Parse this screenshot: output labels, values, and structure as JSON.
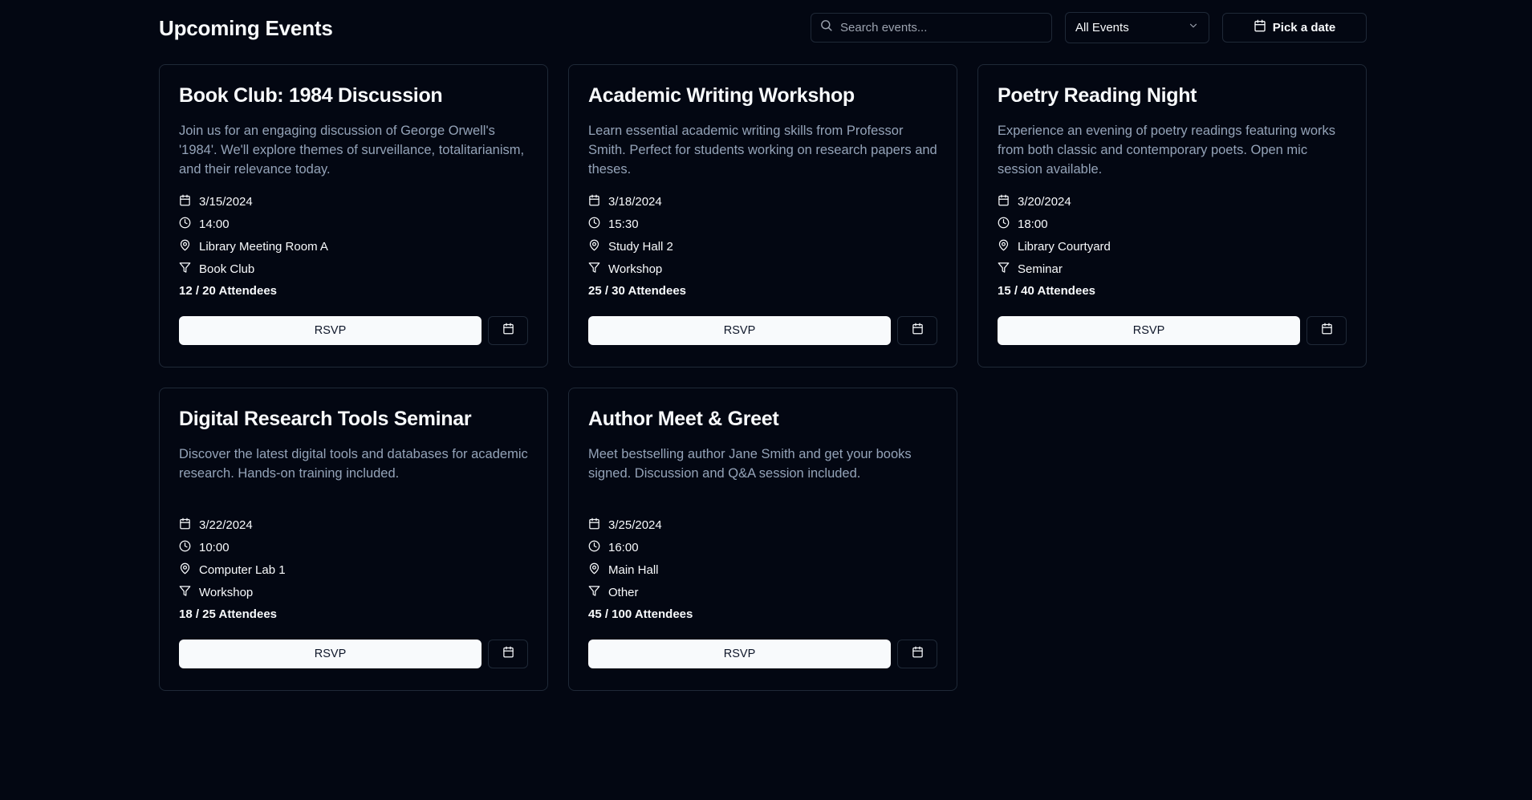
{
  "header": {
    "title": "Upcoming Events",
    "search_placeholder": "Search events...",
    "filter_selected": "All Events",
    "date_button_label": "Pick a date"
  },
  "events": [
    {
      "title": "Book Club: 1984 Discussion",
      "description": "Join us for an engaging discussion of George Orwell's '1984'. We'll explore themes of surveillance, totalitarianism, and their relevance today.",
      "date": "3/15/2024",
      "time": "14:00",
      "location": "Library Meeting Room A",
      "category": "Book Club",
      "attendees": "12 / 20 Attendees",
      "rsvp_label": "RSVP"
    },
    {
      "title": "Academic Writing Workshop",
      "description": "Learn essential academic writing skills from Professor Smith. Perfect for students working on research papers and theses.",
      "date": "3/18/2024",
      "time": "15:30",
      "location": "Study Hall 2",
      "category": "Workshop",
      "attendees": "25 / 30 Attendees",
      "rsvp_label": "RSVP"
    },
    {
      "title": "Poetry Reading Night",
      "description": "Experience an evening of poetry readings featuring works from both classic and contemporary poets. Open mic session available.",
      "date": "3/20/2024",
      "time": "18:00",
      "location": "Library Courtyard",
      "category": "Seminar",
      "attendees": "15 / 40 Attendees",
      "rsvp_label": "RSVP"
    },
    {
      "title": "Digital Research Tools Seminar",
      "description": "Discover the latest digital tools and databases for academic research. Hands-on training included.",
      "date": "3/22/2024",
      "time": "10:00",
      "location": "Computer Lab 1",
      "category": "Workshop",
      "attendees": "18 / 25 Attendees",
      "rsvp_label": "RSVP"
    },
    {
      "title": "Author Meet & Greet",
      "description": "Meet bestselling author Jane Smith and get your books signed. Discussion and Q&A session included.",
      "date": "3/25/2024",
      "time": "16:00",
      "location": "Main Hall",
      "category": "Other",
      "attendees": "45 / 100 Attendees",
      "rsvp_label": "RSVP"
    }
  ],
  "icons": {
    "date": "calendar-icon",
    "time": "clock-icon",
    "location": "map-pin-icon",
    "category": "filter-icon",
    "search": "search-icon",
    "dropdown": "chevron-down-icon"
  },
  "colors": {
    "background": "#030712",
    "border": "#1f2937",
    "text": "#f8fafc",
    "muted_text": "#94a3b8",
    "button_bg": "#f8fafc",
    "button_text": "#0f172a"
  }
}
